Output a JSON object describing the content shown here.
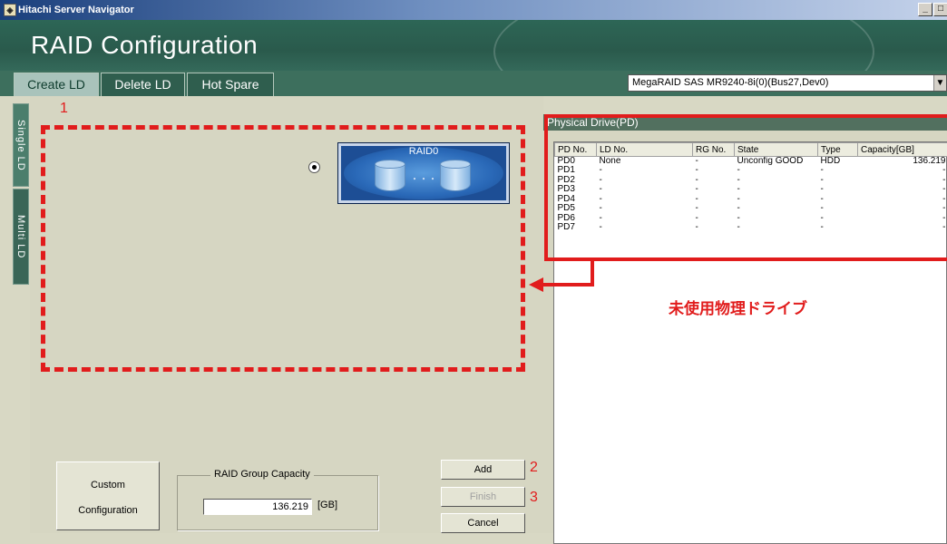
{
  "window": {
    "title": "Hitachi Server Navigator"
  },
  "header": {
    "app_title": "RAID Configuration"
  },
  "tabs": [
    {
      "label": "Create LD",
      "active": true
    },
    {
      "label": "Delete LD",
      "active": false
    },
    {
      "label": "Hot Spare",
      "active": false
    }
  ],
  "controller_select": {
    "value": "MegaRAID SAS MR9240-8i(0)(Bus27,Dev0)"
  },
  "side_tabs": [
    {
      "label": "Single LD",
      "active": true
    },
    {
      "label": "Multi LD",
      "active": false
    }
  ],
  "raid_options": {
    "raid0_label": "RAID0",
    "ellipsis": "・・・",
    "selected": "RAID0"
  },
  "markers": {
    "one": "1",
    "two": "2",
    "three": "3"
  },
  "custom_button": {
    "line1": "Custom",
    "line2": "Configuration"
  },
  "capacity": {
    "legend": "RAID Group Capacity",
    "value": "136.219",
    "unit": "[GB]"
  },
  "actions": {
    "add": "Add",
    "finish": "Finish",
    "cancel": "Cancel"
  },
  "physical_drive": {
    "title": "Physical Drive(PD)",
    "columns": [
      "PD No.",
      "LD No.",
      "RG No.",
      "State",
      "Type",
      "Capacity[GB]"
    ],
    "rows": [
      [
        "PD0",
        "None",
        "-",
        "Unconfig GOOD",
        "HDD",
        "136.219"
      ],
      [
        "PD1",
        "-",
        "-",
        "-",
        "-",
        "-"
      ],
      [
        "PD2",
        "-",
        "-",
        "-",
        "-",
        "-"
      ],
      [
        "PD3",
        "-",
        "-",
        "-",
        "-",
        "-"
      ],
      [
        "PD4",
        "-",
        "-",
        "-",
        "-",
        "-"
      ],
      [
        "PD5",
        "-",
        "-",
        "-",
        "-",
        "-"
      ],
      [
        "PD6",
        "-",
        "-",
        "-",
        "-",
        "-"
      ],
      [
        "PD7",
        "-",
        "-",
        "-",
        "-",
        "-"
      ]
    ]
  },
  "annotation": {
    "text": "未使用物理ドライブ"
  },
  "colors": {
    "accent_red": "#e11c1c",
    "header_green": "#2d6656",
    "raid_blue": "#1d4e95"
  }
}
